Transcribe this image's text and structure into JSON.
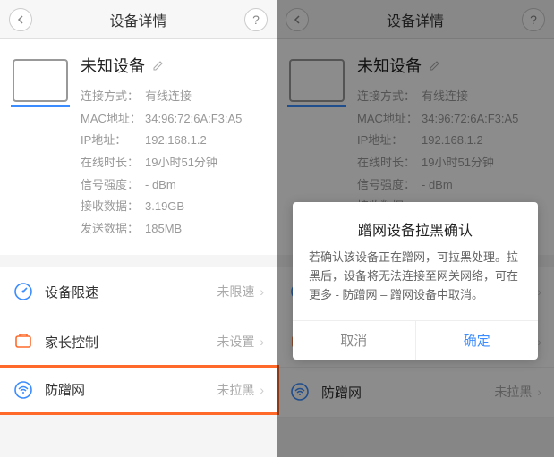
{
  "header": {
    "title": "设备详情"
  },
  "device": {
    "name": "未知设备",
    "rows": [
      {
        "label": "连接方式：",
        "value": "有线连接"
      },
      {
        "label": "MAC地址：",
        "value": "34:96:72:6A:F3:A5"
      },
      {
        "label": "IP地址：",
        "value": "192.168.1.2"
      },
      {
        "label": "在线时长：",
        "value": "19小时51分钟"
      },
      {
        "label": "信号强度：",
        "value": "- dBm"
      },
      {
        "label": "接收数据：",
        "value": "3.19GB"
      },
      {
        "label": "发送数据：",
        "value": "185MB"
      }
    ]
  },
  "list": [
    {
      "label": "设备限速",
      "value": "未限速",
      "icon": "speed-icon",
      "color": "#3b8cff"
    },
    {
      "label": "家长控制",
      "value": "未设置",
      "icon": "parent-icon",
      "color": "#ff6a2a"
    },
    {
      "label": "防蹭网",
      "value": "未拉黑",
      "icon": "shield-icon",
      "color": "#3b8cff"
    }
  ],
  "dialog": {
    "title": "蹭网设备拉黑确认",
    "body": "若确认该设备正在蹭网，可拉黑处理。拉黑后，设备将无法连接至网关网络，可在更多 - 防蹭网 – 蹭网设备中取消。",
    "cancel": "取消",
    "ok": "确定"
  }
}
